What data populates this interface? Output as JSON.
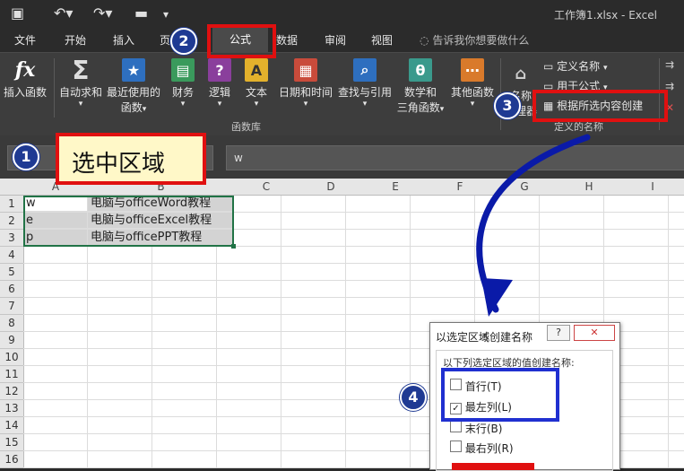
{
  "titlebar": {
    "title": "工作簿1.xlsx - Excel"
  },
  "tabs": [
    {
      "label": "文件"
    },
    {
      "label": "开始"
    },
    {
      "label": "插入"
    },
    {
      "label": "页"
    },
    {
      "label": "公式"
    },
    {
      "label": "数据"
    },
    {
      "label": "审阅"
    },
    {
      "label": "视图"
    }
  ],
  "tell_me": "告诉我你想要做什么",
  "ribbon": {
    "insert_function": "插入函数",
    "autosum": "自动求和",
    "recent_1": "最近使用的",
    "recent_2": "函数",
    "financial": "财务",
    "logical": "逻辑",
    "text": "文本",
    "datetime": "日期和时间",
    "lookup": "查找与引用",
    "math_1": "数学和",
    "math_2": "三角函数",
    "more": "其他函数",
    "group_label": "函数库",
    "name_mgr_1": "名称",
    "name_mgr_2": "管理器",
    "define_name": "定义名称",
    "use_in_formula": "用于公式",
    "create_from_sel": "根据所选内容创建",
    "defined_names_label": "定义的名称"
  },
  "formula_bar": {
    "content": "w"
  },
  "callouts": {
    "c1": "1",
    "c2": "2",
    "c3": "3",
    "c4": "4",
    "select_area": "选中区域"
  },
  "columns": [
    "A",
    "B",
    "C",
    "D",
    "E",
    "F",
    "G",
    "H",
    "I"
  ],
  "rows": [
    "1",
    "2",
    "3",
    "4",
    "5",
    "6",
    "7",
    "8",
    "9",
    "10",
    "11",
    "12",
    "13",
    "14",
    "15",
    "16"
  ],
  "cells": {
    "A1": "w",
    "B1": "电脑与officeWord教程",
    "A2": "e",
    "B2": "电脑与officeExcel教程",
    "A3": "p",
    "B3": "电脑与officePPT教程"
  },
  "dialog": {
    "title": "以选定区域创建名称",
    "help": "?",
    "close": "✕",
    "legend": "以下列选定区域的值创建名称:",
    "opt_top": "首行(T)",
    "top_checked": false,
    "opt_left": "最左列(L)",
    "left_checked": true,
    "opt_bottom": "末行(B)",
    "bottom_checked": false,
    "opt_right": "最右列(R)",
    "right_checked": false
  },
  "colors": {
    "accent_red": "#e01010",
    "accent_blue": "#2030d0",
    "badge": "#1f3a93"
  }
}
